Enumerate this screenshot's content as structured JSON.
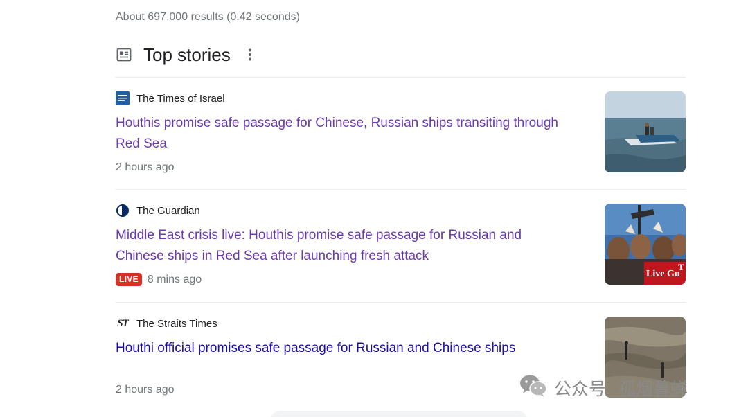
{
  "result_stats": "About 697,000 results (0.42 seconds)",
  "top_stories": {
    "title": "Top stories",
    "header_icon": "newspaper-icon",
    "more_icon": "more-vert-icon"
  },
  "stories": [
    {
      "source": "The Times of Israel",
      "source_icon": "times-of-israel-logo",
      "headline_line1": "Houthis promise safe passage for Chinese, Russian ships transiting through",
      "headline_line2": "Red Sea",
      "time": "2 hours ago",
      "live": false,
      "thumbnail": "speedboat-on-sea-photo"
    },
    {
      "source": "The Guardian",
      "source_icon": "guardian-logo",
      "headline_line1": "Middle East crisis live: Houthis promise safe passage for Russian and",
      "headline_line2": "Chinese ships in Red Sea after launching fresh attack",
      "time": "8 mins ago",
      "live": true,
      "live_label": "LIVE",
      "thumb_overlay": "Live Gu",
      "thumb_overlay_corner": "T",
      "thumbnail": "crowd-protest-photo"
    },
    {
      "source": "The Straits Times",
      "source_icon": "straits-times-logo",
      "source_logo_text": "ST",
      "headline_line1": "Houthi official promises safe passage for Russian and Chinese ships",
      "time": "2 hours ago",
      "live": false,
      "thumbnail": "aerial-ship-deck-photo"
    }
  ],
  "watermark": {
    "label": "公众号",
    "name": "孤烟暮蝉",
    "icon": "wechat-icon"
  },
  "colors": {
    "visited_link": "#6a3ab0",
    "link": "#1a0dab",
    "meta_text": "#70757a",
    "live_badge": "#d93025",
    "divider": "#ebebeb"
  }
}
